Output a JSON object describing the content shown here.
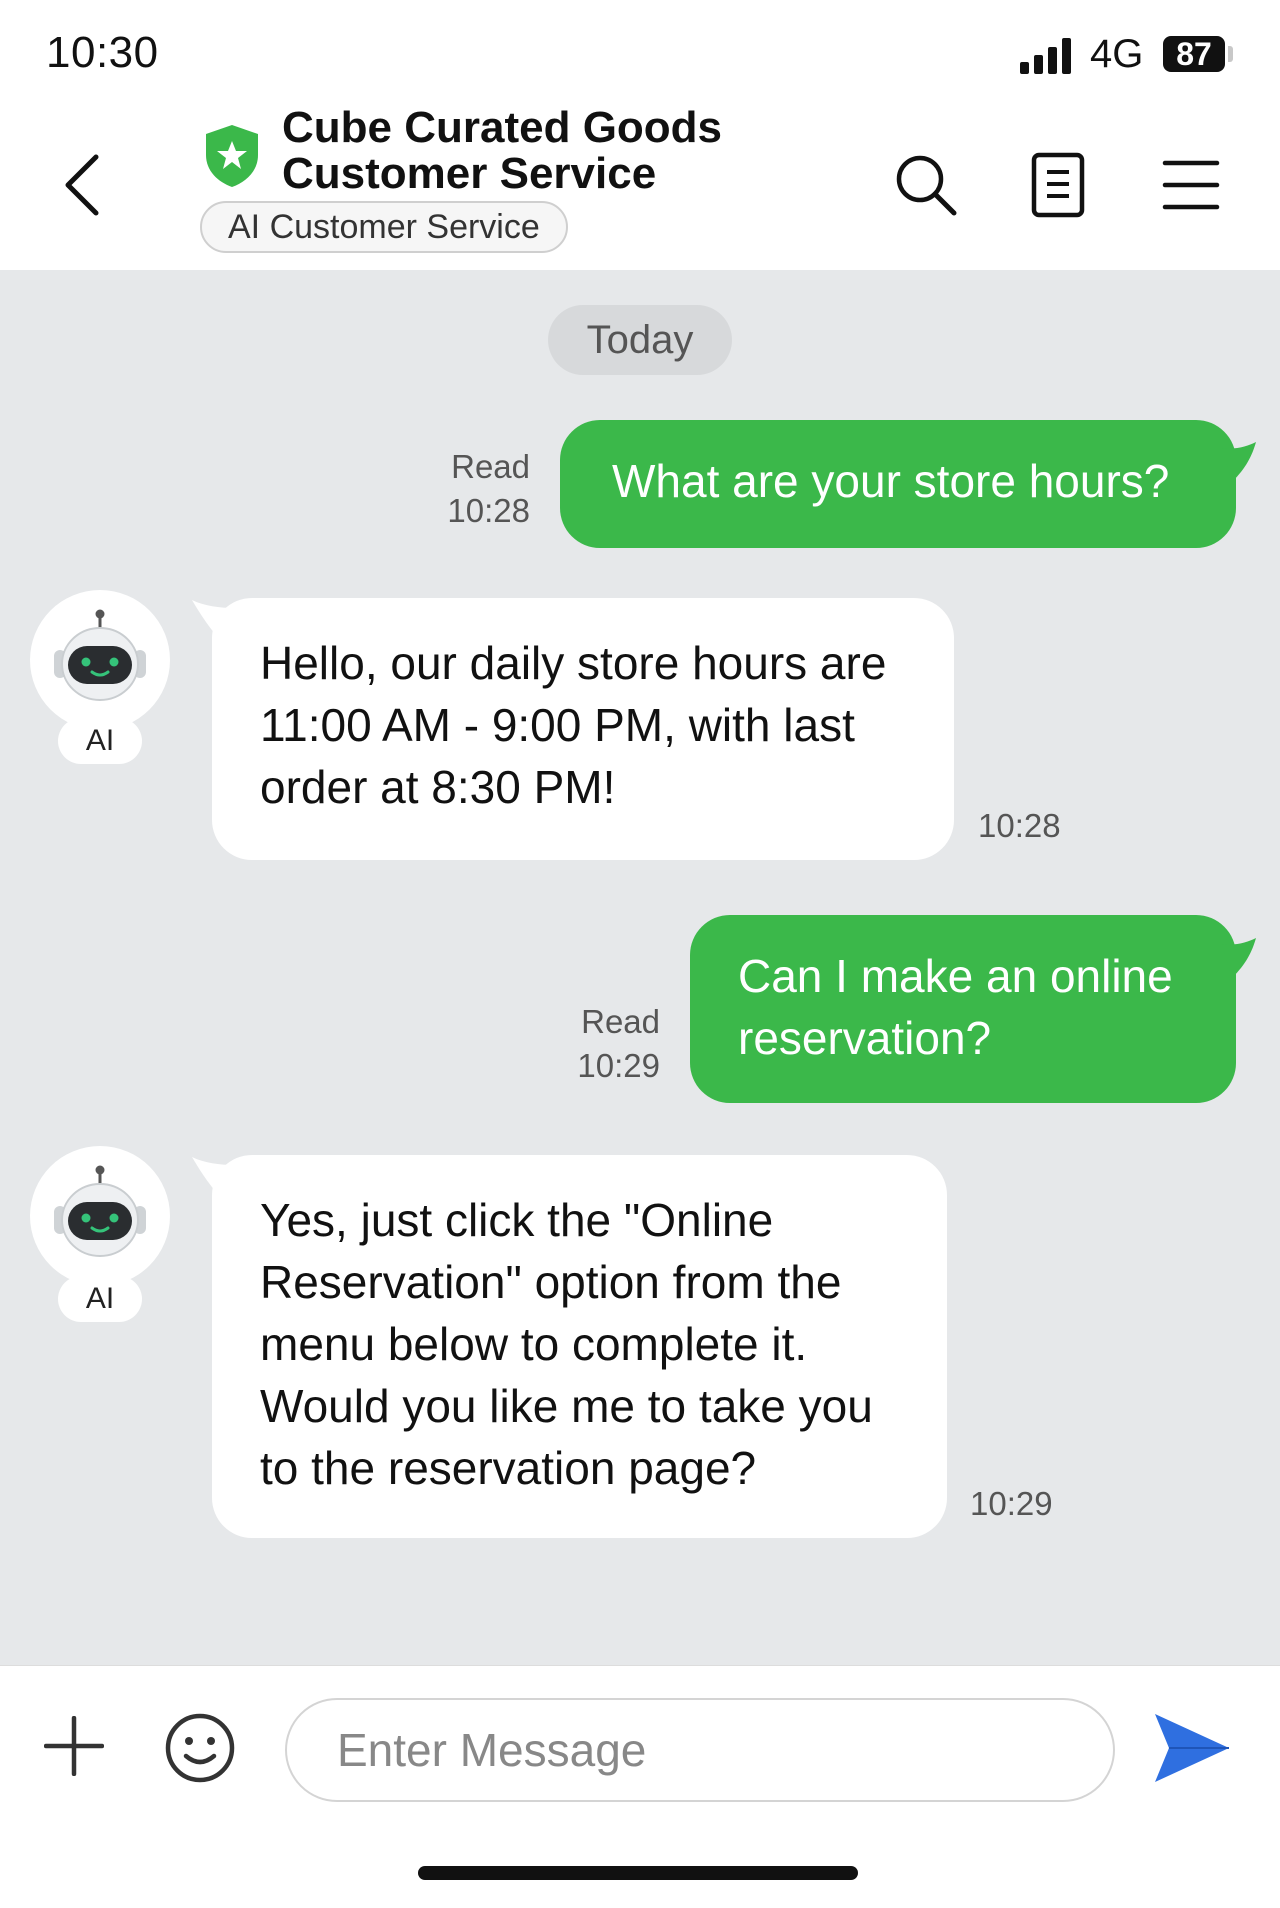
{
  "status_bar": {
    "time": "10:30",
    "network": "4G",
    "battery": "87"
  },
  "header": {
    "title_line1": "Cube Curated Goods",
    "title_line2": "Customer Service",
    "badge": "AI Customer Service",
    "icons": [
      "back-arrow-icon",
      "shield-star-icon",
      "search-icon",
      "document-icon",
      "menu-icon"
    ]
  },
  "chat": {
    "date_label": "Today",
    "messages": [
      {
        "from": "user",
        "text": "What are your store hours?",
        "status": "Read",
        "time": "10:28"
      },
      {
        "from": "ai",
        "avatar_label": "AI",
        "text": "Hello, our daily store hours are 11:00 AM - 9:00 PM, with last order at 8:30 PM!",
        "time": "10:28"
      },
      {
        "from": "user",
        "text": "Can I make an online reservation?",
        "status": "Read",
        "time": "10:29"
      },
      {
        "from": "ai",
        "avatar_label": "AI",
        "text": "Yes, just click the \"Online Reservation\" option from the menu below to complete it. Would you like me to take you to the reservation page?",
        "time": "10:29"
      }
    ]
  },
  "input_bar": {
    "placeholder": "Enter Message",
    "icons": [
      "plus-icon",
      "emoji-icon",
      "send-icon"
    ]
  },
  "colors": {
    "brand_green": "#3bb84a",
    "send_blue": "#2f6fe0",
    "chat_background": "#e6e8ea"
  }
}
